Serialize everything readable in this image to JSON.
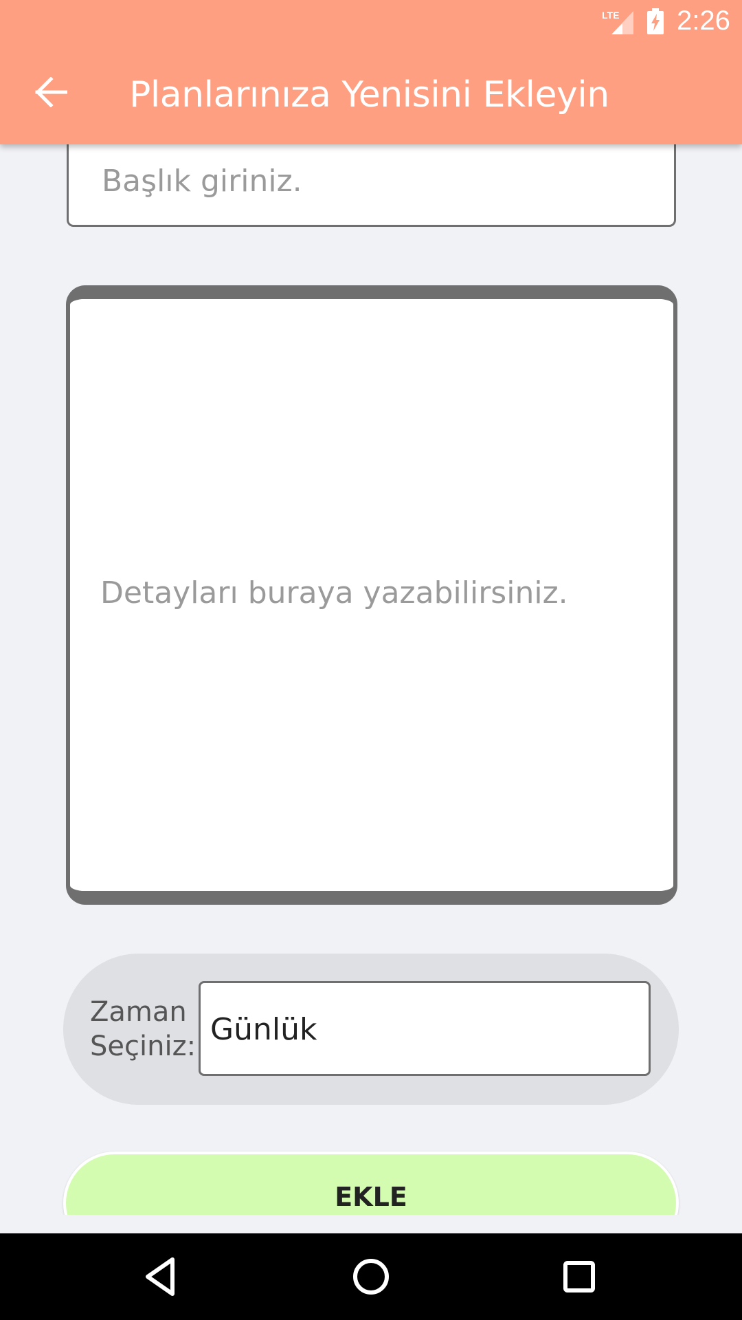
{
  "status_bar": {
    "network_label": "LTE",
    "time": "2:26",
    "icons": [
      "lte-signal-icon",
      "battery-charging-icon"
    ]
  },
  "app_bar": {
    "title": "Planlarınıza Yenisini Ekleyin",
    "back_icon": "arrow-left-icon",
    "background_color": "#ff9f82"
  },
  "form": {
    "title_placeholder": "Başlık giriniz.",
    "details_placeholder": "Detayları buraya yazabilirsiniz.",
    "time_label_line1": "Zaman",
    "time_label_line2": "Seçiniz:",
    "time_selected": "Günlük",
    "submit_label": "EKLE",
    "submit_color": "#d3fcb0"
  },
  "nav_bar": {
    "icons": [
      "nav-back-icon",
      "nav-home-icon",
      "nav-recents-icon"
    ]
  }
}
